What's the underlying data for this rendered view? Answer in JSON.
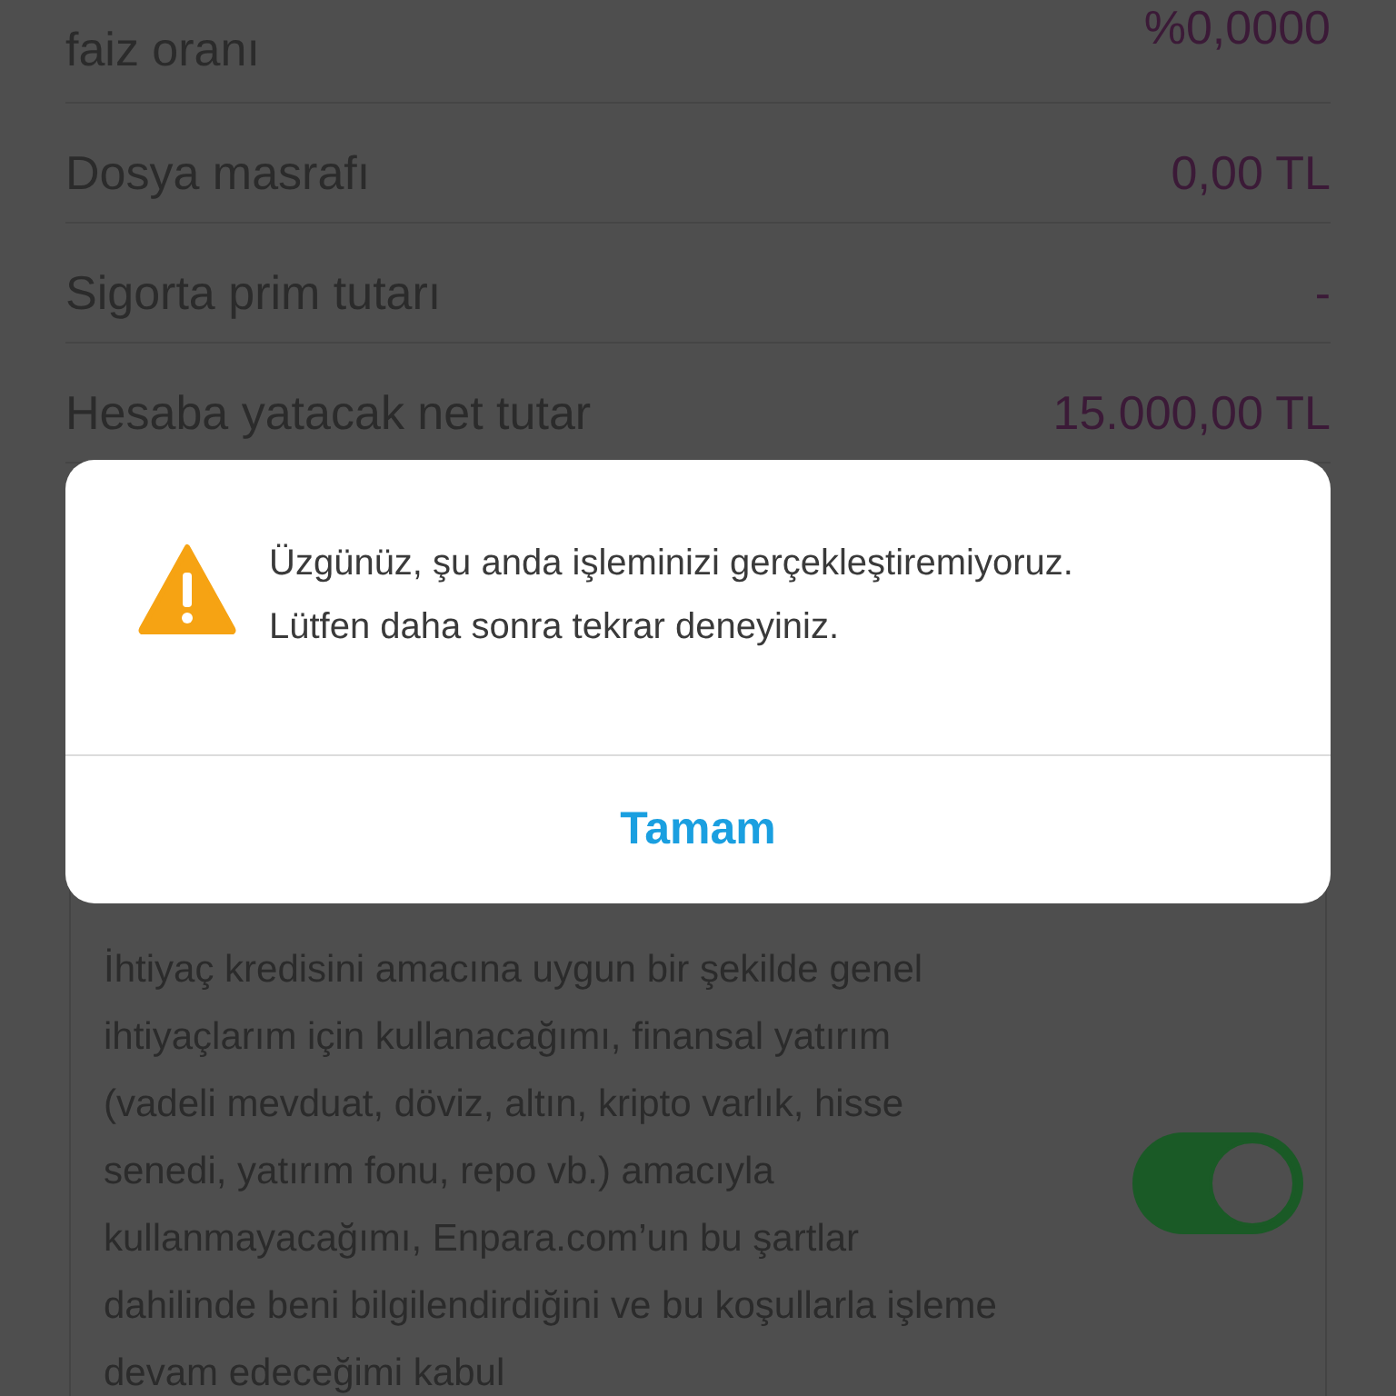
{
  "summary_rows": [
    {
      "label": "faiz oranı",
      "value": "%0,0000"
    },
    {
      "label": "Dosya masrafı",
      "value": "0,00 TL"
    },
    {
      "label": "Sigorta prim tutarı",
      "value": "-"
    },
    {
      "label": "Hesaba yatacak net tutar",
      "value": "15.000,00 TL"
    }
  ],
  "consent": {
    "text": "İhtiyaç kredisini amacına uygun bir şekilde genel ihtiyaçlarım için kullanacağımı, finansal yatırım (vadeli mevduat, döviz, altın, kripto varlık, hisse senedi, yatırım fonu, repo vb.) amacıyla kullanmayacağımı, Enpara.com’un bu şartlar dahilinde beni bilgilendirdiğini ve bu koşullarla işleme devam edeceğimi kabul",
    "on": true
  },
  "alert": {
    "message": "Üzgünüz, şu anda işleminizi gerçekleştiremiyoruz. Lütfen daha sonra tekrar deneyiniz.",
    "button": "Tamam"
  }
}
